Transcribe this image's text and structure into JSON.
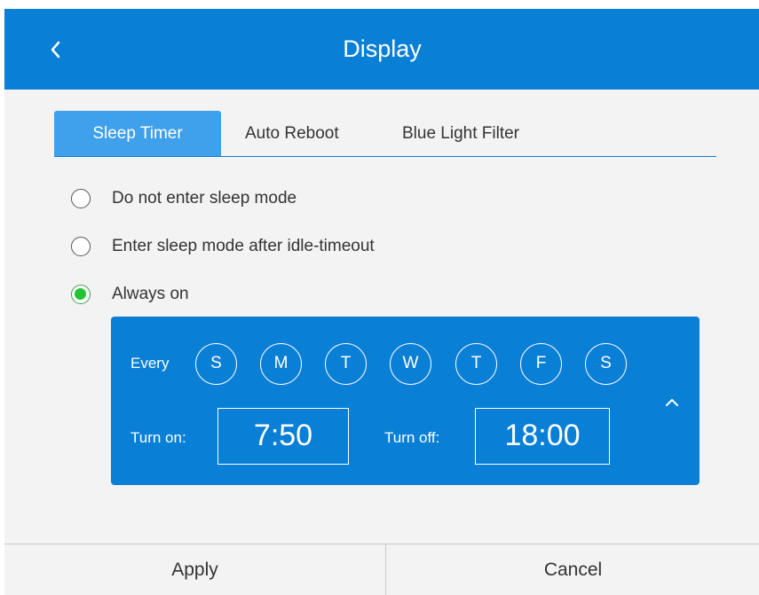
{
  "header": {
    "title": "Display",
    "back_icon": "chevron-left-icon"
  },
  "tabs": [
    {
      "label": "Sleep Timer",
      "active": true
    },
    {
      "label": "Auto Reboot",
      "active": false
    },
    {
      "label": "Blue Light Filter",
      "active": false
    }
  ],
  "options": [
    {
      "label": "Do not enter sleep mode",
      "checked": false
    },
    {
      "label": "Enter sleep mode after idle-timeout",
      "checked": false
    },
    {
      "label": "Always on",
      "checked": true
    }
  ],
  "schedule": {
    "every_label": "Every",
    "days": [
      "S",
      "M",
      "T",
      "W",
      "T",
      "F",
      "S"
    ],
    "turn_on_label": "Turn on:",
    "turn_on_value": "7:50",
    "turn_off_label": "Turn off:",
    "turn_off_value": "18:00",
    "collapse_icon": "chevron-up-icon"
  },
  "footer": {
    "apply_label": "Apply",
    "cancel_label": "Cancel"
  },
  "colors": {
    "accent": "#0a7fd6",
    "active_tab": "#3fa0ec",
    "radio_checked": "#22c433"
  }
}
